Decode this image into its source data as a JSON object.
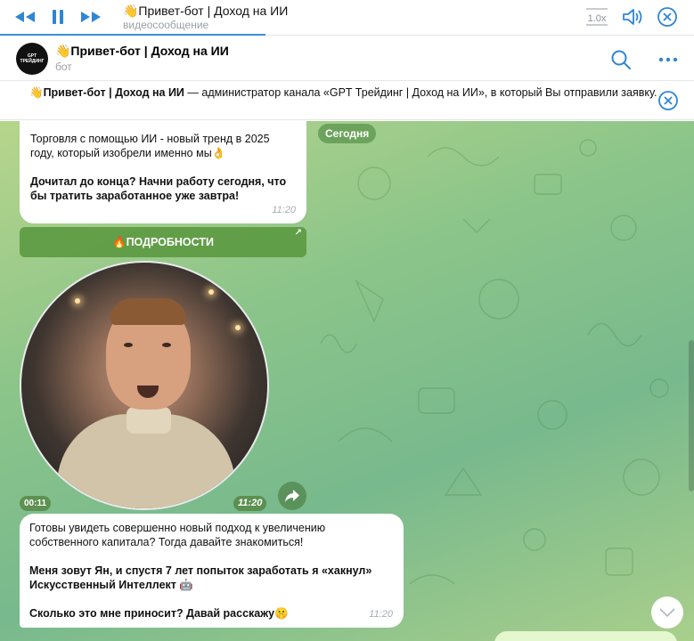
{
  "player": {
    "title": "👋Привет-бот | Доход на ИИ",
    "subtitle": "видеосообщение",
    "speed": "1.0x",
    "progress_fraction": 0.38,
    "icons": [
      "rewind-icon",
      "pause-icon",
      "fast-forward-icon",
      "volume-icon",
      "close-icon"
    ]
  },
  "header": {
    "avatar_text": "GPT ТРЕЙДИНГ",
    "name": "👋Привет-бот | Доход на ИИ",
    "status": "бот",
    "icons": [
      "search-icon",
      "more-icon"
    ]
  },
  "banner": {
    "name": "👋Привет-бот | Доход на ИИ",
    "text": " — администратор канала «GPT Трейдинг | Доход на ИИ», в который Вы отправили заявку."
  },
  "chat": {
    "date": "Сегодня",
    "msg1": {
      "line1": "Торговля с помощью ИИ - новый тренд в 2025 году, который изобрели именно мы👌",
      "line2": "Дочитал до конца? Начни работу сегодня, что бы тратить заработанное уже завтра!",
      "time": "11:20"
    },
    "inline_button": "🔥ПОДРОБНОСТИ",
    "video": {
      "duration": "00:11",
      "time": "11:20"
    },
    "msg2": {
      "line1": "Готовы увидеть совершенно новый подход к увеличению собственного капитала? Тогда давайте знакомиться!",
      "line2": "Меня зовут Ян, и спустя 7 лет попыток заработать я «хакнул» Искусственный Интеллект 🤖",
      "line3": "Сколько это мне приносит? Давай расскажу🤫",
      "time": "11:20"
    }
  },
  "colors": {
    "accent": "#3a8fd6",
    "chat_bg": "#8cc58a",
    "button_green": "#58963c"
  }
}
